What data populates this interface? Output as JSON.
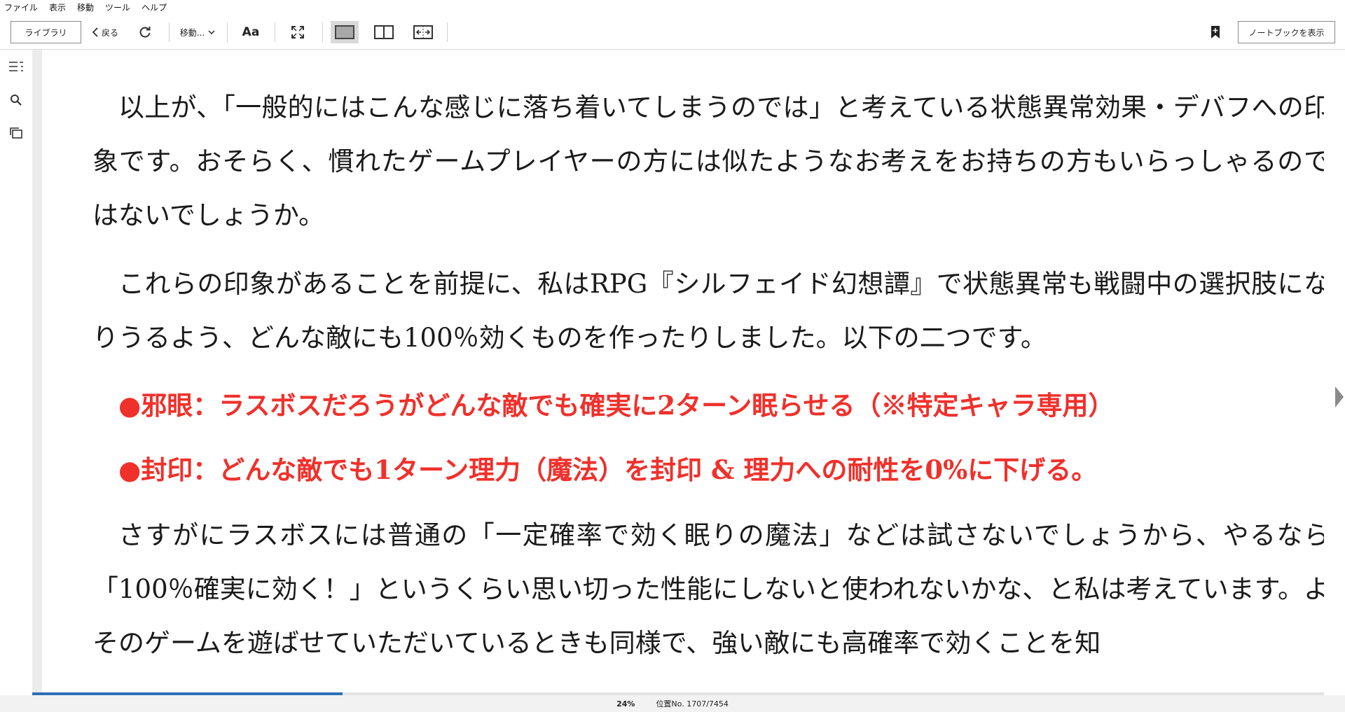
{
  "menu": [
    "ファイル",
    "表示",
    "移動",
    "ツール",
    "ヘルプ"
  ],
  "toolbar": {
    "library_label": "ライブラリ",
    "back_label": "戻る",
    "goto_label": "移動...",
    "font_label": "Aa",
    "notebook_label": "ノートブックを表示"
  },
  "content": {
    "paragraphs": [
      "以上が、「一般的にはこんな感じに落ち着いてしまうのでは」と考えている状態異常効果・デバフへの印象です。おそらく、慣れたゲームプレイヤーの方には似たようなお考えをお持ちの方もいらっしゃるのではないでしょうか。",
      "これらの印象があることを前提に、私はRPG『シルフェイド幻想譚』で状態異常も戦闘中の選択肢になりうるよう、どんな敵にも100％効くものを作ったりしました。以下の二つです。",
      "●邪眼：ラスボスだろうがどんな敵でも確実に2ターン眠らせる（※特定キャラ専用）",
      "●封印：どんな敵でも1ターン理力（魔法）を封印 & 理力への耐性を0%に下げる。",
      "さすがにラスボスには普通の「一定確率で効く眠りの魔法」などは試さないでしょうから、やるなら「100％確実に効く！」というくらい思い切った性能にしないと使われないかな、と私は考えています。よそのゲームを遊ばせていただいているときも同様で、強い敵にも高確率で効くことを知"
    ],
    "highlight_color": "#f0302b"
  },
  "status": {
    "percent": "24%",
    "percent_value": 0.24,
    "location": "位置No. 1707/7454"
  }
}
